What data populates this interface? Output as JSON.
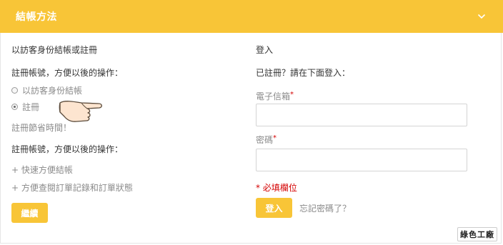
{
  "header": {
    "title": "結帳方法",
    "toggle_icon": "chevron-down-icon"
  },
  "left": {
    "heading": "以訪客身份結帳或註冊",
    "register_prompt": "註冊帳號，方便以後的操作：",
    "options": [
      {
        "label": "以訪客身份結帳",
        "checked": false
      },
      {
        "label": "註冊",
        "checked": true
      }
    ],
    "save_time": "註冊節省時間！",
    "benefits_heading": "註冊帳號，方便以後的操作：",
    "benefits": [
      "+ 快速方便結帳",
      "+ 方便查閱訂單記錄和訂單狀態"
    ],
    "continue_label": "繼續"
  },
  "right": {
    "heading": "登入",
    "subheading": "已註冊？請在下面登入：",
    "email_label": "電子信箱",
    "email_value": "",
    "password_label": "密碼",
    "password_value": "",
    "required_star": "*",
    "required_note": "* 必填欄位",
    "login_label": "登入",
    "forgot_label": "忘記密碼了？"
  },
  "watermark": "綠色工廠",
  "colors": {
    "accent": "#f8c537",
    "required": "#d40000"
  }
}
